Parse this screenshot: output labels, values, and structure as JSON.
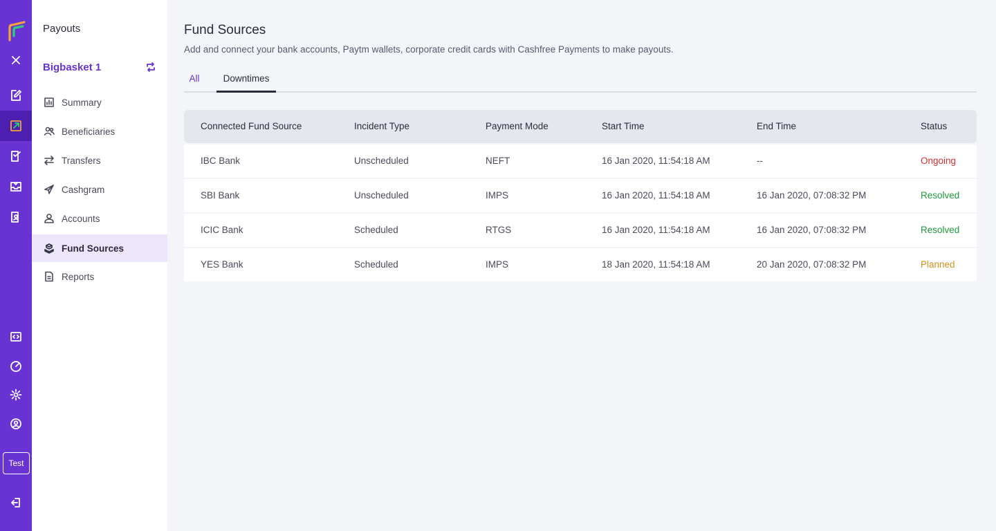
{
  "rail": {
    "items": [
      {
        "name": "close-icon"
      },
      {
        "name": "edit-document-icon"
      },
      {
        "name": "payouts-icon",
        "active": true
      },
      {
        "name": "checklist-icon"
      },
      {
        "name": "mail-box-icon"
      },
      {
        "name": "ledger-icon"
      },
      {
        "name": "developer-code-icon"
      },
      {
        "name": "dashboard-gauge-icon"
      },
      {
        "name": "gear-icon"
      },
      {
        "name": "user-profile-icon"
      }
    ],
    "mode_label": "Test",
    "logout_icon": "logout-icon"
  },
  "subnav": {
    "title": "Payouts",
    "account_name": "Bigbasket 1",
    "items": [
      {
        "label": "Summary",
        "icon": "bar-chart-icon"
      },
      {
        "label": "Beneficiaries",
        "icon": "users-icon"
      },
      {
        "label": "Transfers",
        "icon": "transfer-arrows-icon"
      },
      {
        "label": "Cashgram",
        "icon": "send-plane-icon"
      },
      {
        "label": "Accounts",
        "icon": "user-icon"
      },
      {
        "label": "Fund Sources",
        "icon": "fund-sources-icon",
        "active": true
      },
      {
        "label": "Reports",
        "icon": "document-icon"
      }
    ]
  },
  "page": {
    "title": "Fund Sources",
    "subtitle": "Add and connect your bank accounts, Paytm wallets, corporate credit cards with Cashfree Payments to make payouts."
  },
  "tabs": [
    {
      "label": "All"
    },
    {
      "label": "Downtimes",
      "active": true
    }
  ],
  "table": {
    "columns": [
      "Connected Fund Source",
      "Incident Type",
      "Payment Mode",
      "Start Time",
      "End Time",
      "Status"
    ],
    "rows": [
      [
        "IBC Bank",
        "Unscheduled",
        "NEFT",
        "16 Jan 2020, 11:54:18 AM",
        "--",
        "Ongoing"
      ],
      [
        "SBI Bank",
        "Unscheduled",
        "IMPS",
        "16 Jan 2020, 11:54:18 AM",
        "16 Jan 2020, 07:08:32 PM",
        "Resolved"
      ],
      [
        "ICIC Bank",
        "Scheduled",
        "RTGS",
        "16 Jan 2020, 11:54:18 AM",
        "16 Jan 2020, 07:08:32 PM",
        "Resolved"
      ],
      [
        "YES Bank",
        "Scheduled",
        "IMPS",
        "18 Jan 2020, 11:54:18 AM",
        "20 Jan 2020, 07:08:32 PM",
        "Planned"
      ]
    ]
  },
  "colors": {
    "brand": "#6933d3",
    "status_ongoing": "#d03030",
    "status_resolved": "#1e9a3c",
    "status_planned": "#d6901c"
  }
}
